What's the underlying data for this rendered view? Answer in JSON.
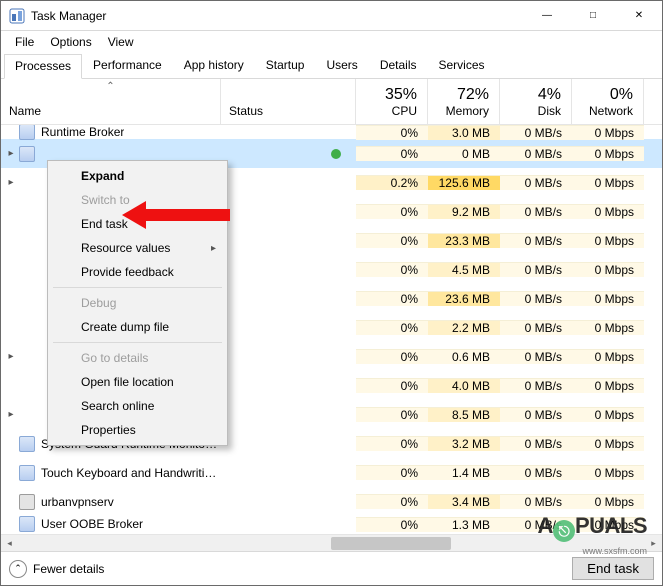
{
  "window": {
    "title": "Task Manager"
  },
  "menu": {
    "file": "File",
    "options": "Options",
    "view": "View"
  },
  "tabs": [
    "Processes",
    "Performance",
    "App history",
    "Startup",
    "Users",
    "Details",
    "Services"
  ],
  "columns": {
    "name": "Name",
    "status": "Status",
    "cpu": {
      "pct": "35%",
      "label": "CPU"
    },
    "memory": {
      "pct": "72%",
      "label": "Memory"
    },
    "disk": {
      "pct": "4%",
      "label": "Disk"
    },
    "network": {
      "pct": "0%",
      "label": "Network"
    }
  },
  "rows": [
    {
      "exp": "",
      "icon": "app",
      "name": "Runtime Broker",
      "leaf": false,
      "cpu": "0%",
      "mem": "3.0 MB",
      "disk": "0 MB/s",
      "net": "0 Mbps",
      "h": [
        0,
        1,
        0,
        0
      ],
      "sel": false,
      "cut": true
    },
    {
      "exp": "▸",
      "icon": "app",
      "name": "",
      "leaf": true,
      "cpu": "0%",
      "mem": "0 MB",
      "disk": "0 MB/s",
      "net": "0 Mbps",
      "h": [
        0,
        0,
        0,
        0
      ],
      "sel": true
    },
    {
      "exp": "▸",
      "icon": "",
      "name": "",
      "leaf": false,
      "cpu": "0.2%",
      "mem": "125.6 MB",
      "disk": "0 MB/s",
      "net": "0 Mbps",
      "h": [
        1,
        3,
        0,
        0
      ],
      "sel": false
    },
    {
      "exp": "",
      "icon": "",
      "name": "",
      "leaf": false,
      "cpu": "0%",
      "mem": "9.2 MB",
      "disk": "0 MB/s",
      "net": "0 Mbps",
      "h": [
        0,
        1,
        0,
        0
      ],
      "sel": false
    },
    {
      "exp": "",
      "icon": "",
      "name": "",
      "leaf": false,
      "cpu": "0%",
      "mem": "23.3 MB",
      "disk": "0 MB/s",
      "net": "0 Mbps",
      "h": [
        0,
        2,
        0,
        0
      ],
      "sel": false
    },
    {
      "exp": "",
      "icon": "",
      "name": "",
      "leaf": false,
      "cpu": "0%",
      "mem": "4.5 MB",
      "disk": "0 MB/s",
      "net": "0 Mbps",
      "h": [
        0,
        1,
        0,
        0
      ],
      "sel": false
    },
    {
      "exp": "",
      "icon": "",
      "name": "",
      "leaf": false,
      "cpu": "0%",
      "mem": "23.6 MB",
      "disk": "0 MB/s",
      "net": "0 Mbps",
      "h": [
        0,
        2,
        0,
        0
      ],
      "sel": false
    },
    {
      "exp": "",
      "icon": "",
      "name": "",
      "leaf": false,
      "cpu": "0%",
      "mem": "2.2 MB",
      "disk": "0 MB/s",
      "net": "0 Mbps",
      "h": [
        0,
        1,
        0,
        0
      ],
      "sel": false
    },
    {
      "exp": "▸",
      "icon": "",
      "name": "",
      "leaf": false,
      "cpu": "0%",
      "mem": "0.6 MB",
      "disk": "0 MB/s",
      "net": "0 Mbps",
      "h": [
        0,
        0,
        0,
        0
      ],
      "sel": false
    },
    {
      "exp": "",
      "icon": "",
      "name": "",
      "leaf": false,
      "cpu": "0%",
      "mem": "4.0 MB",
      "disk": "0 MB/s",
      "net": "0 Mbps",
      "h": [
        0,
        1,
        0,
        0
      ],
      "sel": false
    },
    {
      "exp": "▸",
      "icon": "",
      "name": "",
      "leaf": false,
      "cpu": "0%",
      "mem": "8.5 MB",
      "disk": "0 MB/s",
      "net": "0 Mbps",
      "h": [
        0,
        1,
        0,
        0
      ],
      "sel": false
    },
    {
      "exp": "",
      "icon": "app",
      "name": "System Guard Runtime Monitor…",
      "leaf": false,
      "cpu": "0%",
      "mem": "3.2 MB",
      "disk": "0 MB/s",
      "net": "0 Mbps",
      "h": [
        0,
        1,
        0,
        0
      ],
      "sel": false
    },
    {
      "exp": "",
      "icon": "app",
      "name": "Touch Keyboard and Handwriti…",
      "leaf": false,
      "cpu": "0%",
      "mem": "1.4 MB",
      "disk": "0 MB/s",
      "net": "0 Mbps",
      "h": [
        0,
        0,
        0,
        0
      ],
      "sel": false
    },
    {
      "exp": "",
      "icon": "svc",
      "name": "urbanvpnserv",
      "leaf": false,
      "cpu": "0%",
      "mem": "3.4 MB",
      "disk": "0 MB/s",
      "net": "0 Mbps",
      "h": [
        0,
        1,
        0,
        0
      ],
      "sel": false
    },
    {
      "exp": "",
      "icon": "app",
      "name": "User OOBE Broker",
      "leaf": false,
      "cpu": "0%",
      "mem": "1.3 MB",
      "disk": "0 MB/s",
      "net": "0 Mbps",
      "h": [
        0,
        0,
        0,
        0
      ],
      "sel": false,
      "cut": true
    }
  ],
  "context": {
    "expand": "Expand",
    "switch": "Switch to",
    "end": "End task",
    "resv": "Resource values",
    "feedback": "Provide feedback",
    "debug": "Debug",
    "dump": "Create dump file",
    "goto": "Go to details",
    "open": "Open file location",
    "search": "Search online",
    "props": "Properties"
  },
  "footer": {
    "fewer": "Fewer details",
    "end": "End task"
  },
  "watermark": {
    "brand_a": "A",
    "brand_b": "PUALS",
    "sub": "www.sxsfm.com"
  }
}
